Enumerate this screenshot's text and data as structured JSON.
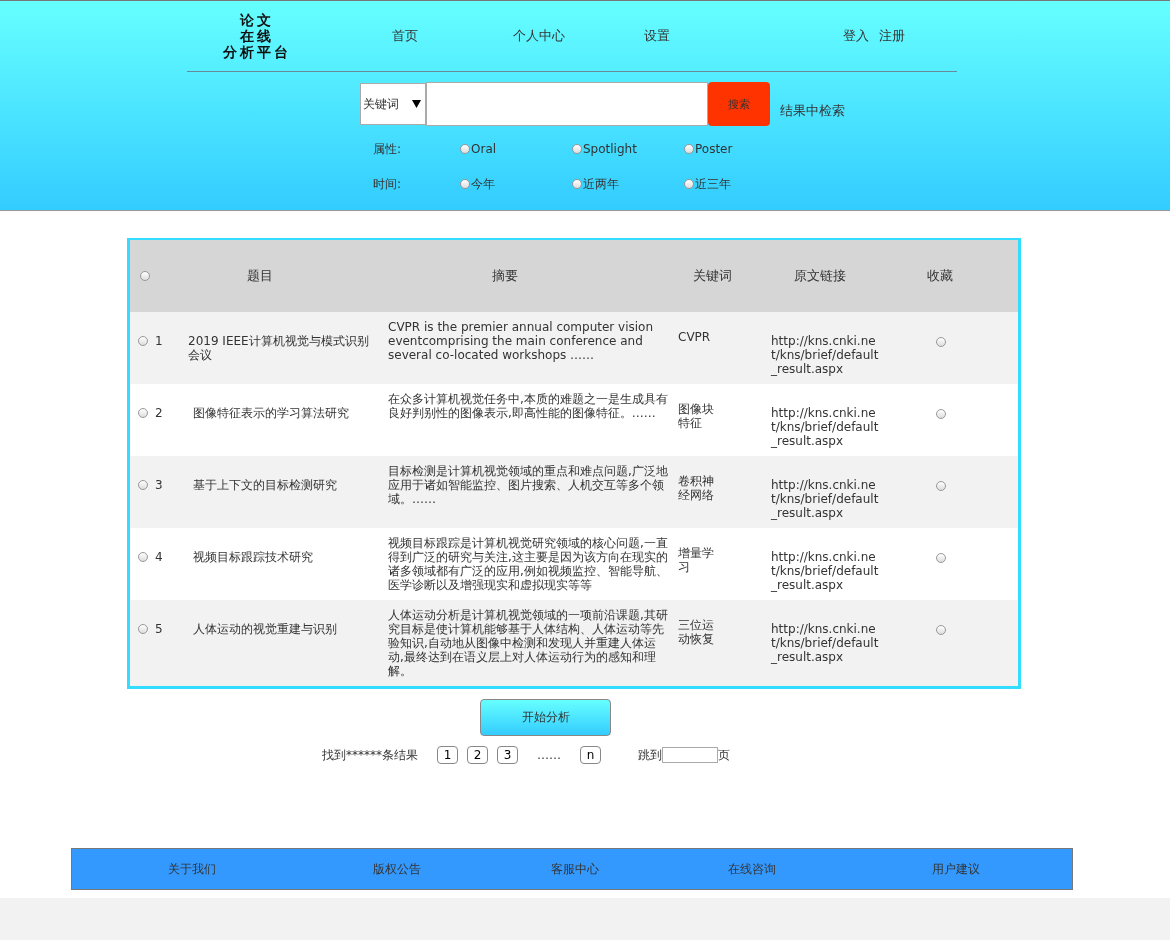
{
  "logo": {
    "lines": [
      "论文",
      "在线",
      "分析平台"
    ]
  },
  "nav": {
    "items": [
      "首页",
      "个人中心",
      "设置"
    ],
    "auth": [
      "登入",
      "注册"
    ]
  },
  "search": {
    "field_type": "关键词",
    "button": "搜索",
    "in_results": "结果中检索"
  },
  "filters": [
    {
      "label": "属性:",
      "options": [
        {
          "label": "Oral",
          "selected": false
        },
        {
          "label": "Spotlight",
          "selected": false
        },
        {
          "label": "Poster",
          "selected": false
        }
      ]
    },
    {
      "label": "时间:",
      "options": [
        {
          "label": "今年",
          "selected": false
        },
        {
          "label": "近两年",
          "selected": false
        },
        {
          "label": "近三年",
          "selected": false
        }
      ]
    }
  ],
  "table": {
    "select_all": false,
    "columns": [
      "题目",
      "摘要",
      "关键词",
      "原文链接",
      "收藏"
    ],
    "rows": [
      {
        "selected": false,
        "index": "1",
        "title": "2019 IEEE计算机视觉与模式识别会议",
        "abstract": "CVPR is the premier annual computer vision eventcomprising the main conference and several co-located workshops ……",
        "keywords": "CVPR",
        "link": "http://kns.cnki.net/kns/brief/default_result.aspx",
        "favorited": false
      },
      {
        "selected": false,
        "index": "2",
        "title": "图像特征表示的学习算法研究",
        "abstract": "在众多计算机视觉任务中,本质的难题之一是生成具有良好判别性的图像表示,即高性能的图像特征。……",
        "keywords": "图像块特征",
        "link": "http://kns.cnki.net/kns/brief/default_result.aspx",
        "favorited": false
      },
      {
        "selected": false,
        "index": "3",
        "title": "基于上下文的目标检测研究",
        "abstract": "目标检测是计算机视觉领域的重点和难点问题,广泛地应用于诸如智能监控、图片搜索、人机交互等多个领域。……",
        "keywords": "卷积神经网络",
        "link": "http://kns.cnki.net/kns/brief/default_result.aspx",
        "favorited": false
      },
      {
        "selected": false,
        "index": "4",
        "title": "视频目标跟踪技术研究",
        "abstract": "视频目标跟踪是计算机视觉研究领域的核心问题,一直得到广泛的研究与关注,这主要是因为该方向在现实的诸多领域都有广泛的应用,例如视频监控、智能导航、医学诊断以及增强现实和虚拟现实等等",
        "keywords": "增量学习",
        "link": "http://kns.cnki.net/kns/brief/default_result.aspx",
        "favorited": false
      },
      {
        "selected": false,
        "index": "5",
        "title": "人体运动的视觉重建与识别",
        "abstract": "人体运动分析是计算机视觉领域的一项前沿课题,其研究目标是使计算机能够基于人体结构、人体运动等先验知识,自动地从图像中检测和发现人并重建人体运动,最终达到在语义层上对人体运动行为的感知和理解。",
        "keywords": "三位运动恢复",
        "link": "http://kns.cnki.net/kns/brief/default_result.aspx",
        "favorited": false
      }
    ]
  },
  "analyze_button": "开始分析",
  "pagination": {
    "found": "找到******条结果",
    "pages": [
      "1",
      "2",
      "3"
    ],
    "ellipsis": "……",
    "last": "n",
    "jump_label": "跳到",
    "jump_suffix": "页"
  },
  "footer": [
    "关于我们",
    "版权公告",
    "客服中心",
    "在线咨询",
    "用户建议"
  ]
}
